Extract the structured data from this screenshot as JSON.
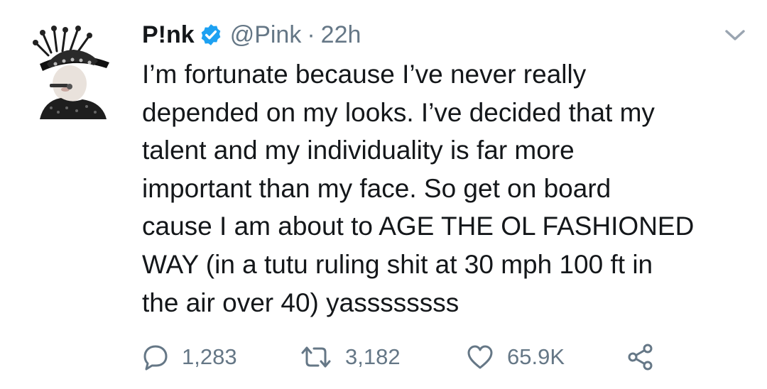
{
  "tweet": {
    "author": {
      "display_name": "P!nk",
      "handle": "@Pink",
      "separator": "·",
      "time": "22h",
      "verified_icon": "verified-badge-icon",
      "accent_color": "#1da1f2"
    },
    "text": "I’m fortunate because I’ve never really\ndepended on my looks. I’ve decided that my\ntalent and my individuality is far more\nimportant than my face. So get on board\ncause I am about to AGE THE OL FASHIONED\nWAY (in a tutu ruling shit at 30 mph 100 ft in\nthe air over 40) yassssssss",
    "actions": {
      "reply_count": "1,283",
      "retweet_count": "3,182",
      "like_count": "65.9K"
    },
    "icons": [
      "chevron-down-icon",
      "reply-icon",
      "retweet-icon",
      "like-icon",
      "share-icon"
    ],
    "text_color": "#14171a",
    "secondary_color": "#657786"
  }
}
